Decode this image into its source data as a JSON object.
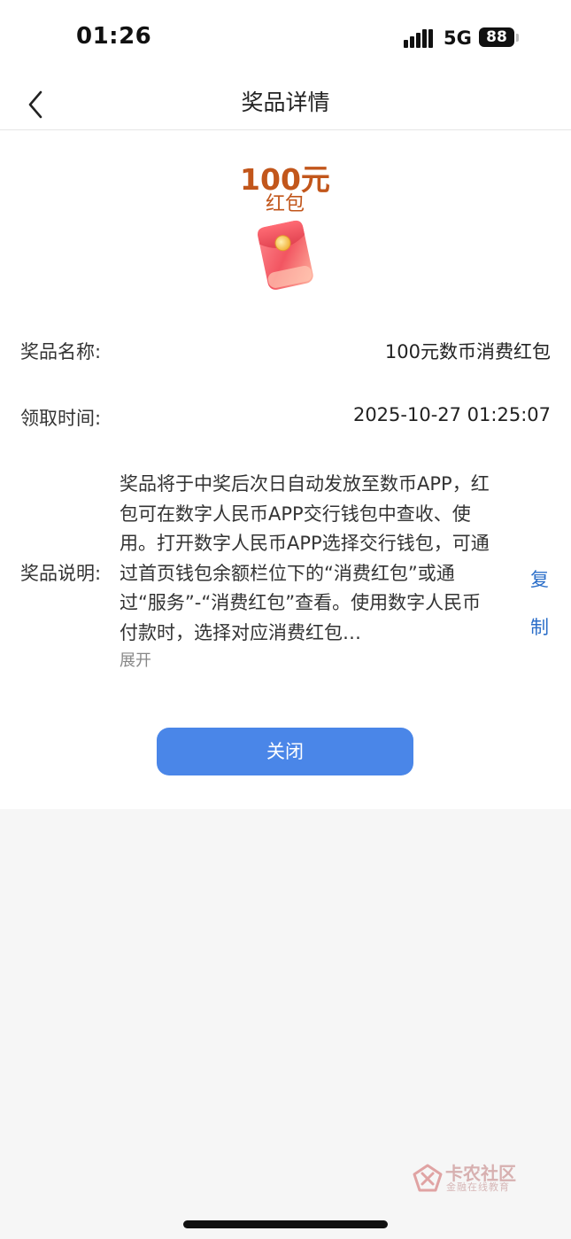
{
  "status_bar": {
    "time": "01:26",
    "network": "5G",
    "battery": "88"
  },
  "nav": {
    "title": "奖品详情"
  },
  "prize": {
    "amount": "100元",
    "type": "红包"
  },
  "rows": {
    "name_label": "奖品名称:",
    "name_value": "100元数币消费红包",
    "time_label": "领取时间:",
    "time_value": "2025-10-27 01:25:07",
    "desc_label": "奖品说明:",
    "desc_text": "奖品将于中奖后次日自动发放至数币APP，红包可在数字人民币APP交行钱包中查收、使用。打开数字人民币APP选择交行钱包，可通过首页钱包余额栏位下的“消费红包”或通过“服务”-“消费红包”查看。使用数字人民币付款时，选择对应消费红包…",
    "expand_label": "展开",
    "copy_label": "复制"
  },
  "actions": {
    "close_label": "关闭"
  },
  "watermark": {
    "title": "卡农社区",
    "subtitle": "金融在线教育"
  },
  "colors": {
    "accent": "#4a86e8",
    "prize": "#c2561b",
    "link": "#2c6fc9",
    "background": "#f6f6f6"
  }
}
